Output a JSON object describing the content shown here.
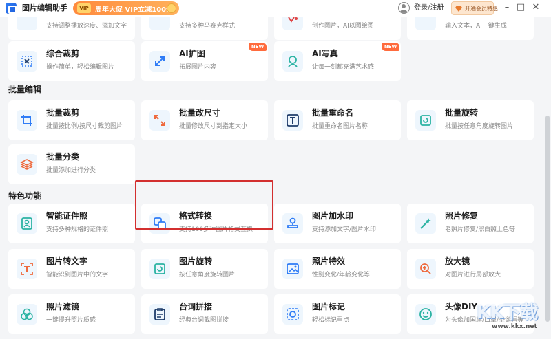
{
  "app": {
    "title": "图片编辑助手"
  },
  "promo": {
    "vip": "VIP",
    "text": "周年大促 VIP立减100元"
  },
  "account": {
    "login": "登录/注册",
    "vip_badge": "开通会员特惠"
  },
  "window": {
    "minimize": "–",
    "maximize": "□",
    "close": "✕"
  },
  "cards_top_partial": [
    {
      "desc": "支持调整播放速度、添加文字"
    },
    {
      "desc": "支持多种马赛克样式"
    },
    {
      "desc": "创作图片，AI以图绘图"
    },
    {
      "desc": "输入文本，AI一键生成"
    }
  ],
  "row_top": [
    {
      "title": "综合裁剪",
      "desc": "操作简单，轻松编辑图片"
    },
    {
      "title": "AI扩图",
      "desc": "拓展图片内容",
      "badge": "NEW"
    },
    {
      "title": "AI写真",
      "desc": "让每一刻都充满艺术感",
      "badge": "NEW"
    }
  ],
  "sections": {
    "batch": "批量编辑",
    "special": "特色功能"
  },
  "batch": [
    {
      "title": "批量裁剪",
      "desc": "批量按比例/按尺寸裁剪图片"
    },
    {
      "title": "批量改尺寸",
      "desc": "批量修改尺寸到指定大小"
    },
    {
      "title": "批量重命名",
      "desc": "批量重命名图片名称"
    },
    {
      "title": "批量旋转",
      "desc": "批量按任意角度旋转图片"
    },
    {
      "title": "批量分类",
      "desc": "批量添加进行分类"
    }
  ],
  "special": [
    {
      "title": "智能证件照",
      "desc": "支持多种规格的证件照"
    },
    {
      "title": "格式转换",
      "desc": "支持100多种图片格式互换"
    },
    {
      "title": "图片加水印",
      "desc": "支持添加文字/图片水印"
    },
    {
      "title": "照片修复",
      "desc": "老照片修复/黑白照上色等"
    },
    {
      "title": "图片转文字",
      "desc": "智能识别图片中的文字"
    },
    {
      "title": "图片旋转",
      "desc": "按任意角度旋转图片"
    },
    {
      "title": "照片特效",
      "desc": "性别变化/年龄变化等"
    },
    {
      "title": "放大镜",
      "desc": "对图片进行局部放大"
    },
    {
      "title": "照片滤镜",
      "desc": "一键提升照片质感"
    },
    {
      "title": "台词拼接",
      "desc": "经典台词截图拼接"
    },
    {
      "title": "图片标记",
      "desc": "轻松标记重点"
    },
    {
      "title": "头像DIY",
      "desc": "为头像加国旗/口罩/圣诞帽等"
    }
  ],
  "watermark": {
    "logo": "KK下载",
    "url": "www.kkx.net"
  },
  "colors": {
    "accent": "#2f7cf6",
    "highlight": "#d32f2f",
    "new_badge": "#ff6b3d"
  }
}
